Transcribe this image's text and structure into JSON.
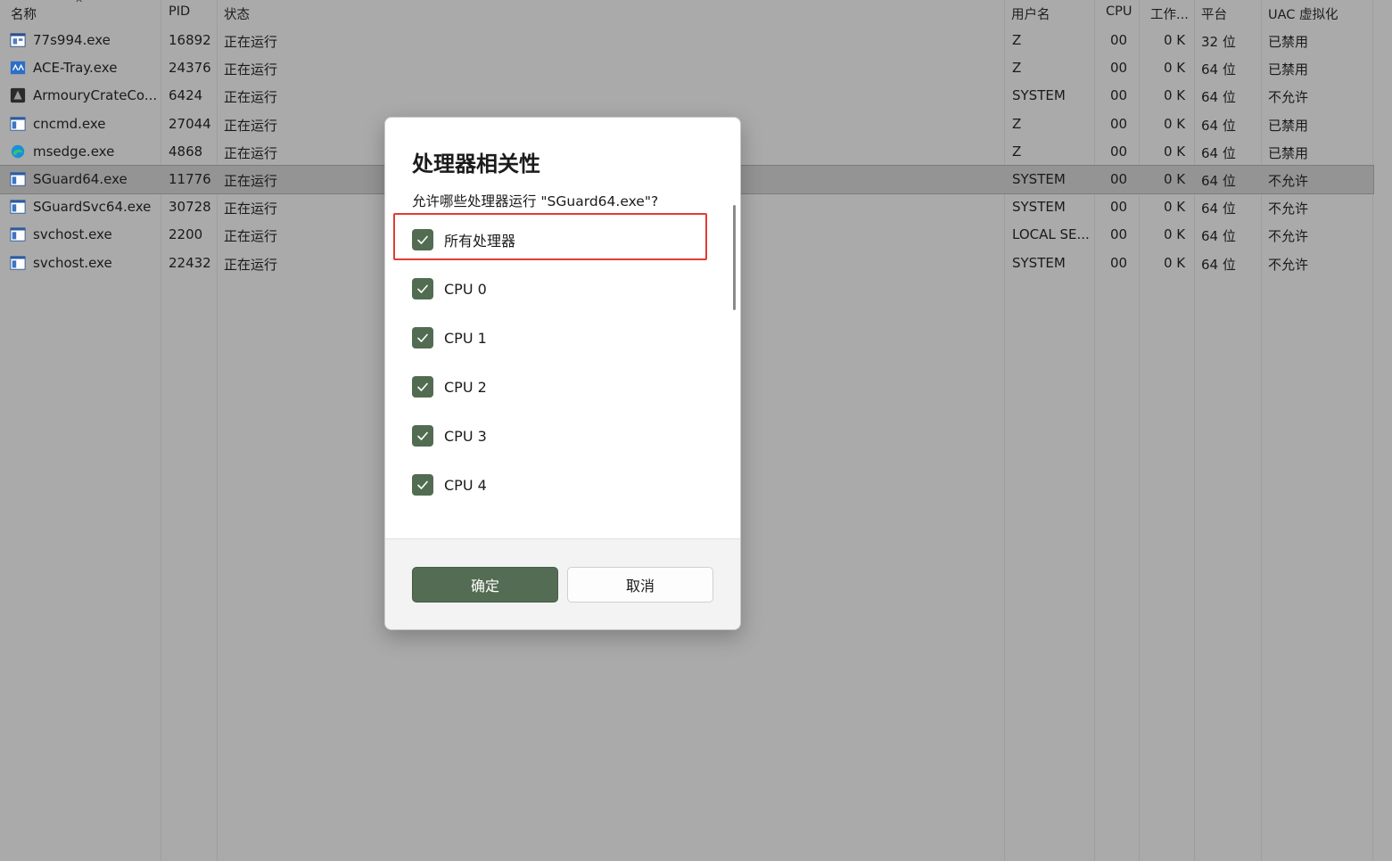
{
  "table": {
    "headers": {
      "name": "名称",
      "pid": "PID",
      "status": "状态",
      "user": "用户名",
      "cpu": "CPU",
      "working_set": "工作...",
      "platform": "平台",
      "uac": "UAC 虚拟化"
    },
    "rows": [
      {
        "name": "77s994.exe",
        "pid": "16892",
        "status": "正在运行",
        "user": "Z",
        "cpu": "00",
        "mem": "0 K",
        "platform": "32 位",
        "uac": "已禁用",
        "icon": "app-window-icon"
      },
      {
        "name": "ACE-Tray.exe",
        "pid": "24376",
        "status": "正在运行",
        "user": "Z",
        "cpu": "00",
        "mem": "0 K",
        "platform": "64 位",
        "uac": "已禁用",
        "icon": "ace-icon"
      },
      {
        "name": "ArmouryCrateCo...",
        "pid": "6424",
        "status": "正在运行",
        "user": "SYSTEM",
        "cpu": "00",
        "mem": "0 K",
        "platform": "64 位",
        "uac": "不允许",
        "icon": "armoury-crate-icon"
      },
      {
        "name": "cncmd.exe",
        "pid": "27044",
        "status": "正在运行",
        "user": "Z",
        "cpu": "00",
        "mem": "0 K",
        "platform": "64 位",
        "uac": "已禁用",
        "icon": "window-icon"
      },
      {
        "name": "msedge.exe",
        "pid": "4868",
        "status": "正在运行",
        "user": "Z",
        "cpu": "00",
        "mem": "0 K",
        "platform": "64 位",
        "uac": "已禁用",
        "icon": "edge-icon"
      },
      {
        "name": "SGuard64.exe",
        "pid": "11776",
        "status": "正在运行",
        "user": "SYSTEM",
        "cpu": "00",
        "mem": "0 K",
        "platform": "64 位",
        "uac": "不允许",
        "icon": "window-icon"
      },
      {
        "name": "SGuardSvc64.exe",
        "pid": "30728",
        "status": "正在运行",
        "user": "SYSTEM",
        "cpu": "00",
        "mem": "0 K",
        "platform": "64 位",
        "uac": "不允许",
        "icon": "window-icon"
      },
      {
        "name": "svchost.exe",
        "pid": "2200",
        "status": "正在运行",
        "user": "LOCAL SE...",
        "cpu": "00",
        "mem": "0 K",
        "platform": "64 位",
        "uac": "不允许",
        "icon": "window-icon"
      },
      {
        "name": "svchost.exe",
        "pid": "22432",
        "status": "正在运行",
        "user": "SYSTEM",
        "cpu": "00",
        "mem": "0 K",
        "platform": "64 位",
        "uac": "不允许",
        "icon": "window-icon"
      }
    ]
  },
  "dialog": {
    "title": "处理器相关性",
    "question": "允许哪些处理器运行 \"SGuard64.exe\"?",
    "options": [
      {
        "label": "所有处理器",
        "checked": true
      },
      {
        "label": "CPU 0",
        "checked": true
      },
      {
        "label": "CPU 1",
        "checked": true
      },
      {
        "label": "CPU 2",
        "checked": true
      },
      {
        "label": "CPU 3",
        "checked": true
      },
      {
        "label": "CPU 4",
        "checked": true
      }
    ],
    "ok_label": "确定",
    "cancel_label": "取消"
  },
  "colors": {
    "accent": "#536c53",
    "highlight": "#e23b32",
    "overlay": "#aaaaaa"
  }
}
